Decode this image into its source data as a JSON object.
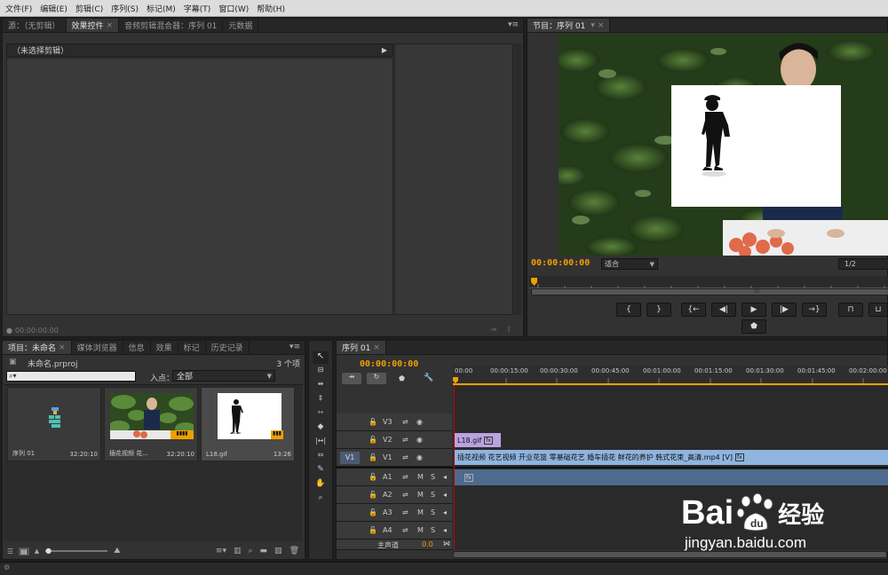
{
  "menu": [
    "文件(F)",
    "编辑(E)",
    "剪辑(C)",
    "序列(S)",
    "标记(M)",
    "字幕(T)",
    "窗口(W)",
    "帮助(H)"
  ],
  "source_panel": {
    "tabs": [
      "源：（无剪辑）",
      "效果控件",
      "音频剪辑混合器：序列 01",
      "元数据"
    ],
    "no_clip": "（未选择剪辑）",
    "timecode": "00:00:00:00"
  },
  "program_monitor": {
    "tab": "节目：序列 01",
    "timecode": "00:00:00:00",
    "fit": "适合",
    "resolution": "1/2",
    "mid_mark": "|||"
  },
  "project_panel": {
    "tabs": [
      "项目：未命名",
      "媒体浏览器",
      "信息",
      "效果",
      "标记",
      "历史记录"
    ],
    "project_file": "未命名.prproj",
    "item_count": "3 个项",
    "search_placeholder": "",
    "in_point_label": "入点：",
    "in_point_value": "全部",
    "items": [
      {
        "name": "序列 01",
        "duration": "32:20:10"
      },
      {
        "name": "插花视频 花...",
        "duration": "32:20:10"
      },
      {
        "name": "L18.gif",
        "duration": "13:26"
      }
    ]
  },
  "timeline": {
    "tab": "序列 01",
    "timecode": "00:00:00:00",
    "ruler": [
      "00:00",
      "00:00:15:00",
      "00:00:30:00",
      "00:00:45:00",
      "00:01:00:00",
      "00:01:15:00",
      "00:01:30:00",
      "00:01:45:00",
      "00:02:00:00"
    ],
    "video_tracks": [
      "V3",
      "V2",
      "V1"
    ],
    "audio_tracks": [
      "A1",
      "A2",
      "A3",
      "A4"
    ],
    "source_patch": "V1",
    "master": "主声道",
    "master_value": "0.0",
    "mute": "M",
    "solo": "S",
    "clips": {
      "v2": "L18.gif",
      "v1": "插花视频 花艺视频 开业花篮 零基础花艺 婚车插花 鲜花的养护 韩式花束_高清.mp4 [V]"
    }
  },
  "watermark": {
    "brand": "Bai",
    "suffix": "经验",
    "url": "jingyan.baidu.com"
  },
  "colors": {
    "timecode": "#f0a000",
    "clip_video": "#8fb4e0",
    "clip_gif": "#b9a2e0",
    "clip_audio": "#4e6a8e",
    "playhead": "#d00000"
  }
}
